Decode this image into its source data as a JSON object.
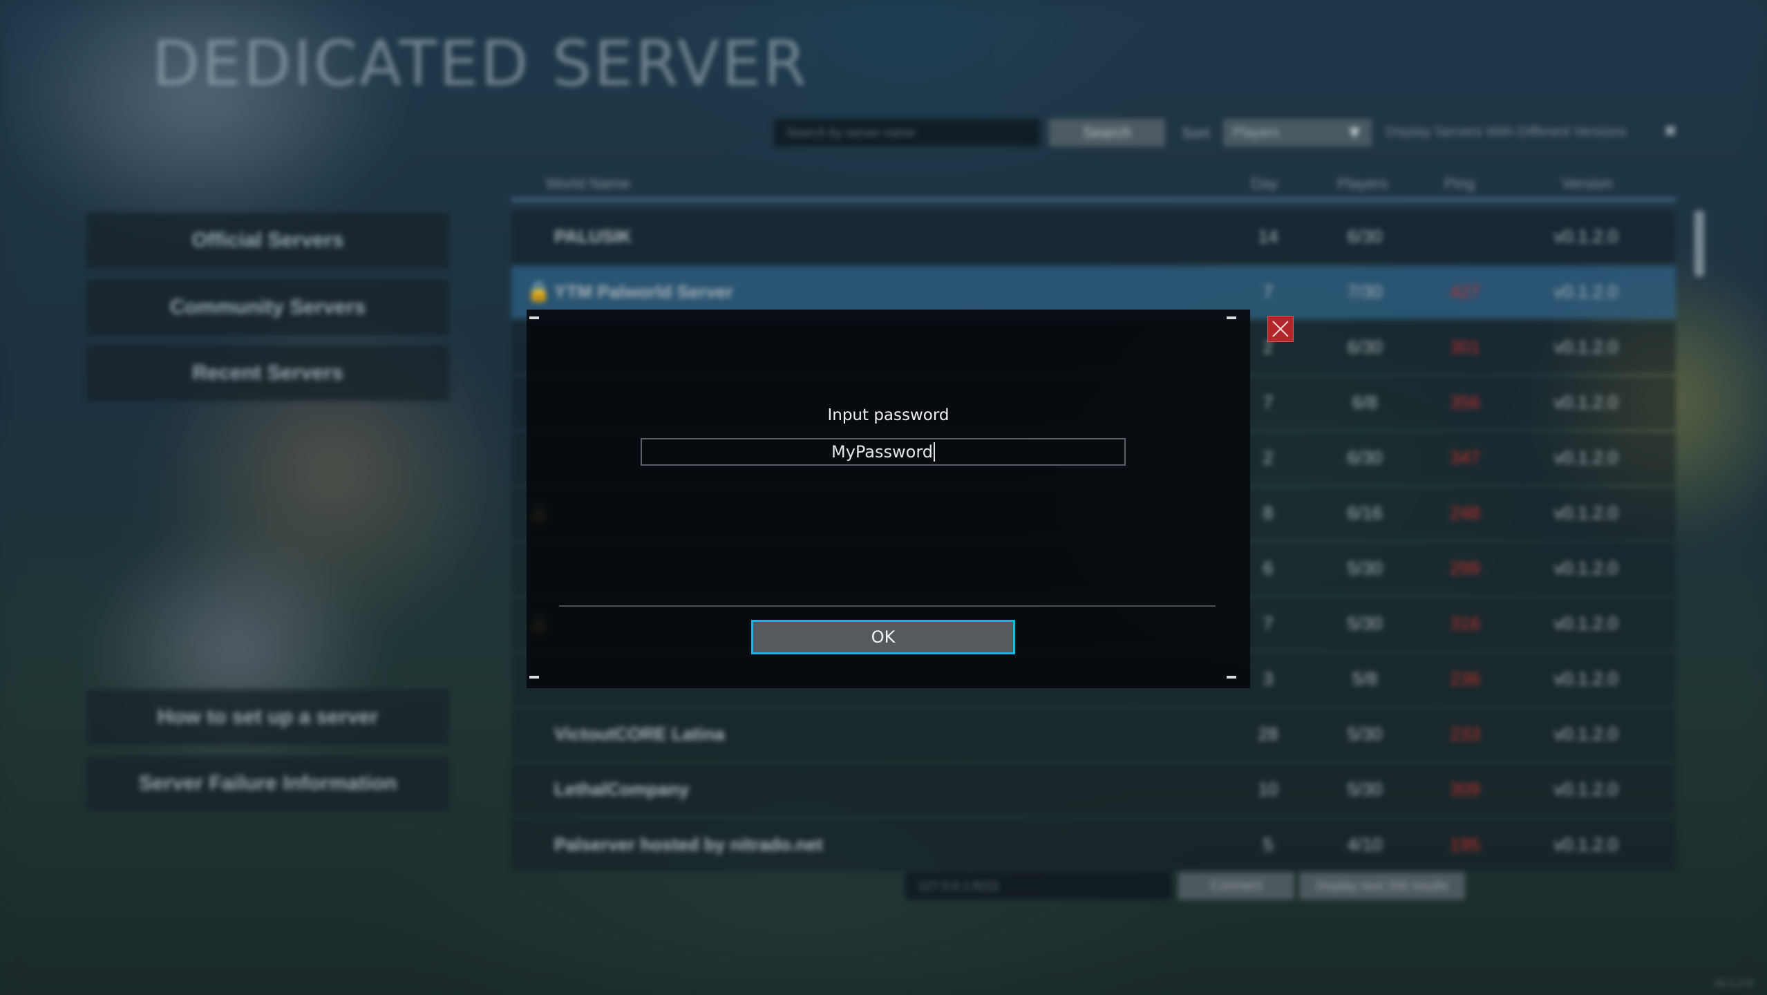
{
  "header": {
    "title": "DEDICATED SERVER"
  },
  "nav": {
    "official": "Official Servers",
    "community": "Community Servers",
    "recent": "Recent Servers",
    "howto": "How to set up a server",
    "failure": "Server Failure Information"
  },
  "search": {
    "placeholder": "Search by server name",
    "button": "Search",
    "sort_label": "Sort",
    "sort_value": "Players",
    "version_filter": "Display Servers With Different Versions"
  },
  "table": {
    "columns": {
      "name": "World Name",
      "day": "Day",
      "players": "Players",
      "ping": "Ping",
      "version": "Version"
    },
    "rows": [
      {
        "name": "PALUSIK",
        "day": "14",
        "players": "6/30",
        "ping": "",
        "version": "v0.1.2.0"
      },
      {
        "name": "YTM Palworld Server",
        "day": "7",
        "players": "7/30",
        "ping": "427",
        "version": "v0.1.2.0"
      },
      {
        "name": "",
        "day": "2",
        "players": "6/30",
        "ping": "301",
        "version": "v0.1.2.0"
      },
      {
        "name": "",
        "day": "7",
        "players": "6/8",
        "ping": "356",
        "version": "v0.1.2.0"
      },
      {
        "name": "",
        "day": "2",
        "players": "6/30",
        "ping": "347",
        "version": "v0.1.2.0"
      },
      {
        "name": "",
        "day": "8",
        "players": "6/16",
        "ping": "248",
        "version": "v0.1.2.0"
      },
      {
        "name": "",
        "day": "6",
        "players": "5/30",
        "ping": "299",
        "version": "v0.1.2.0"
      },
      {
        "name": "",
        "day": "7",
        "players": "5/30",
        "ping": "316",
        "version": "v0.1.2.0"
      },
      {
        "name": "",
        "day": "3",
        "players": "5/8",
        "ping": "236",
        "version": "v0.1.2.0"
      },
      {
        "name": "VictoutCORE Latina",
        "day": "28",
        "players": "5/30",
        "ping": "233",
        "version": "v0.1.2.0"
      },
      {
        "name": "LethalCompany",
        "day": "10",
        "players": "5/30",
        "ping": "309",
        "version": "v0.1.2.0"
      },
      {
        "name": "Palserver hosted by nitrado.net",
        "day": "5",
        "players": "4/10",
        "ping": "195",
        "version": "v0.1.2.0"
      }
    ]
  },
  "connect": {
    "ip_placeholder": "127.0.0.1:8211",
    "button": "Connect",
    "display_count": "Display next 200 results"
  },
  "footer": {
    "version": "v0.1.2.0"
  },
  "modal": {
    "heading": "Input password",
    "password_value": "MyPassword",
    "ok_label": "OK"
  },
  "colors": {
    "accent": "#19b6e3",
    "close": "#b3262a",
    "ping_bad": "#c03030"
  }
}
